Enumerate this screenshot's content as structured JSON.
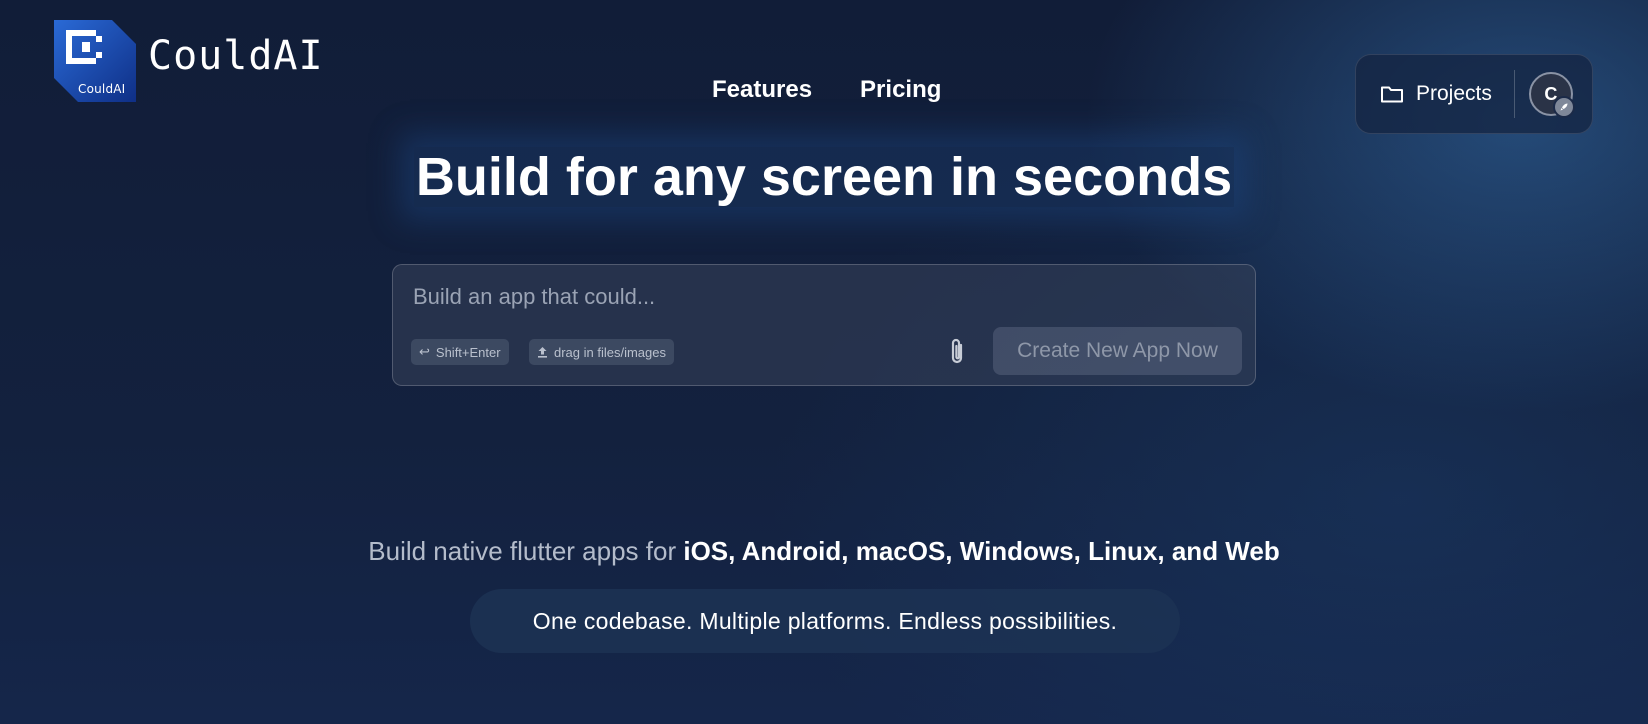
{
  "brand": {
    "mark_text": "CouldAI",
    "wordmark": "CouldAI",
    "mark_color": "#1e56b8"
  },
  "nav": {
    "items": [
      {
        "label": "Features"
      },
      {
        "label": "Pricing"
      }
    ]
  },
  "account": {
    "projects_label": "Projects",
    "projects_icon": "folder-icon",
    "avatar_initial": "C",
    "avatar_badge_icon": "rocket-icon"
  },
  "hero": {
    "title": "Build for any screen in seconds"
  },
  "prompt": {
    "placeholder": "Build an app that could...",
    "value": "",
    "shift_enter_chip": "Shift+Enter",
    "drag_chip": "drag in files/images",
    "attach_icon": "paperclip-icon",
    "create_button": "Create New App Now"
  },
  "platforms": {
    "prefix": "Build native flutter apps for",
    "list": "iOS, Android, macOS, Windows, Linux, and Web"
  },
  "tagline": "One codebase. Multiple platforms. Endless possibilities."
}
